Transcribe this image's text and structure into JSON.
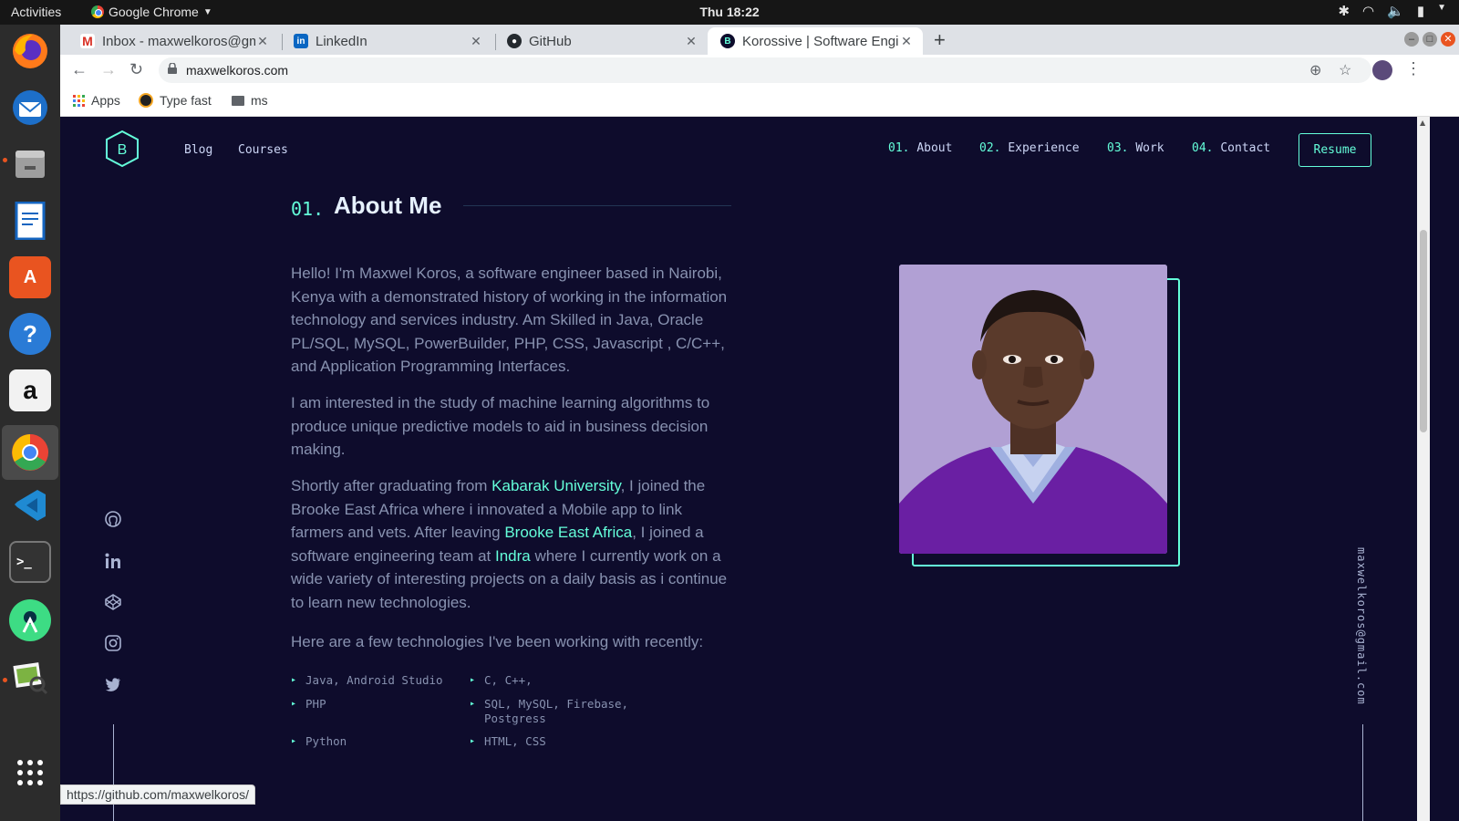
{
  "topbar": {
    "activities": "Activities",
    "app_name": "Google Chrome",
    "clock": "Thu 18:22"
  },
  "tabs": [
    {
      "title": "Inbox - maxwelkoros@gm",
      "icon": "gmail-icon",
      "color": "#d93025"
    },
    {
      "title": "LinkedIn",
      "icon": "linkedin-icon",
      "color": "#0a66c2"
    },
    {
      "title": "GitHub",
      "icon": "github-icon",
      "color": "#24292e"
    },
    {
      "title": "Korossive | Software Engi",
      "icon": "site-logo-icon",
      "color": "#0e0c2c"
    }
  ],
  "address_bar": {
    "url": "maxwelkoros.com"
  },
  "bookmarks": [
    {
      "label": "Apps",
      "icon": "apps-grid-icon"
    },
    {
      "label": "Type fast",
      "icon": "typefast-icon"
    },
    {
      "label": "ms",
      "icon": "folder-icon"
    }
  ],
  "site": {
    "logo_letter": "B",
    "nav_left": [
      "Blog",
      "Courses"
    ],
    "nav_right": [
      {
        "num": "01.",
        "label": "About"
      },
      {
        "num": "02.",
        "label": "Experience"
      },
      {
        "num": "03.",
        "label": "Work"
      },
      {
        "num": "04.",
        "label": "Contact"
      }
    ],
    "resume": "Resume",
    "accent_color": "#64ffda",
    "background_color": "#0e0c2c"
  },
  "about": {
    "number": "01.",
    "title": "About Me",
    "p1": "Hello! I'm Maxwel Koros, a software engineer based in Nairobi, Kenya with a demonstrated history of working in the information technology and services industry. Am Skilled in Java, Oracle PL/SQL, MySQL, PowerBuilder, PHP, CSS, Javascript , C/C++, and Application Programming Interfaces.",
    "p2": "I am interested in the study of machine learning algorithms to produce unique predictive models to aid in business decision making.",
    "p3": {
      "a": "Shortly after graduating from ",
      "link1": "Kabarak University",
      "b": ", I joined the Brooke East Africa where i innovated a Mobile app to link farmers and vets. After leaving ",
      "link2": "Brooke East Africa",
      "c": ", I joined a software engineering team at ",
      "link3": "Indra",
      "d": " where I currently work on a wide variety of interesting projects on a daily basis as i continue to learn new technologies."
    },
    "p4": "Here are a few technologies I've been working with recently:",
    "technologies": [
      "Java, Android Studio",
      "C, C++,",
      "PHP",
      "SQL, MySQL, Firebase, Postgress",
      "Python",
      "HTML, CSS"
    ]
  },
  "socials": [
    "github-icon",
    "linkedin-icon",
    "codepen-icon",
    "instagram-icon",
    "twitter-icon"
  ],
  "email": "maxwelkoros@gmail.com",
  "status_url": "https://github.com/maxwelkoros/"
}
